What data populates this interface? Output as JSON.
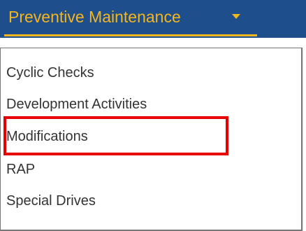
{
  "navbar": {
    "menu_label": "Preventive Maintenance",
    "menu_icon": "chevron-down-icon",
    "background_color": "#1f4e8d",
    "accent_color": "#f2b51d"
  },
  "dropdown": {
    "items": [
      {
        "label": "Cyclic Checks"
      },
      {
        "label": "Development Activities"
      },
      {
        "label": "Modifications",
        "highlighted": true
      },
      {
        "label": "RAP"
      },
      {
        "label": "Special Drives"
      }
    ]
  },
  "annotation": {
    "highlight_color": "#e60000"
  }
}
